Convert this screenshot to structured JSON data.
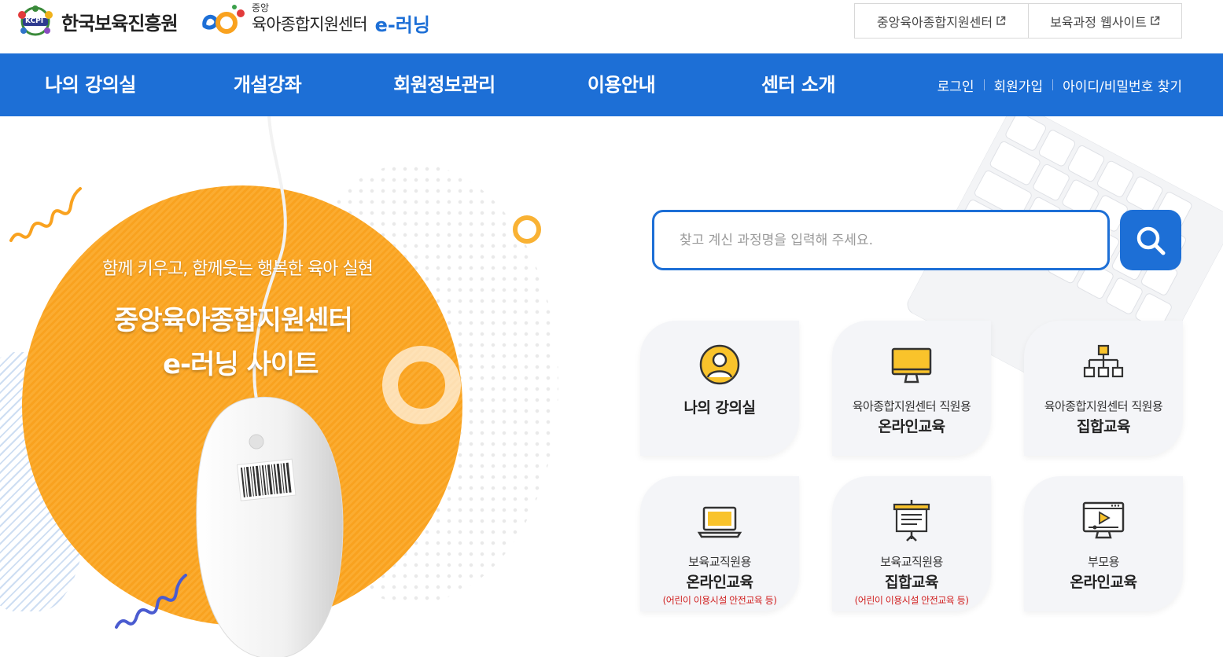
{
  "header": {
    "kcpi_logo_label": "KCPI",
    "kcpi_name": "한국보육진흥원",
    "center_small": "중앙",
    "center_name": "육아종합지원센터",
    "center_elearning": "e-러닝",
    "external_links": [
      {
        "label": "중앙육아종합지원센터",
        "icon": "external-link-icon"
      },
      {
        "label": "보육과정 웹사이트",
        "icon": "external-link-icon"
      }
    ]
  },
  "nav": {
    "items": [
      "나의 강의실",
      "개설강좌",
      "회원정보관리",
      "이용안내",
      "센터 소개"
    ],
    "util": [
      "로그인",
      "회원가입",
      "아이디/비밀번호 찾기"
    ]
  },
  "hero": {
    "subtitle": "함께 키우고, 함께웃는 행복한 육아 실현",
    "title_line1": "중앙육아종합지원센터",
    "title_line2": "e-러닝 사이트"
  },
  "search": {
    "placeholder": "찾고 계신 과정명을 입력해 주세요.",
    "value": ""
  },
  "tiles": [
    {
      "sub": "",
      "main": "나의 강의실",
      "note": "",
      "icon": "user-circle-icon"
    },
    {
      "sub": "육아종합지원센터 직원용",
      "main": "온라인교육",
      "note": "",
      "icon": "monitor-icon"
    },
    {
      "sub": "육아종합지원센터 직원용",
      "main": "집합교육",
      "note": "",
      "icon": "org-chart-icon"
    },
    {
      "sub": "보육교직원용",
      "main": "온라인교육",
      "note": "(어린이 이용시설 안전교육 등)",
      "icon": "laptop-icon"
    },
    {
      "sub": "보육교직원용",
      "main": "집합교육",
      "note": "(어린이 이용시설 안전교육 등)",
      "icon": "presentation-board-icon"
    },
    {
      "sub": "부모용",
      "main": "온라인교육",
      "note": "",
      "icon": "video-player-icon"
    }
  ],
  "colors": {
    "primary": "#1d6fd6",
    "orange": "#f9a21f",
    "icon_yellow": "#f9c32b",
    "note_red": "#d12222"
  }
}
